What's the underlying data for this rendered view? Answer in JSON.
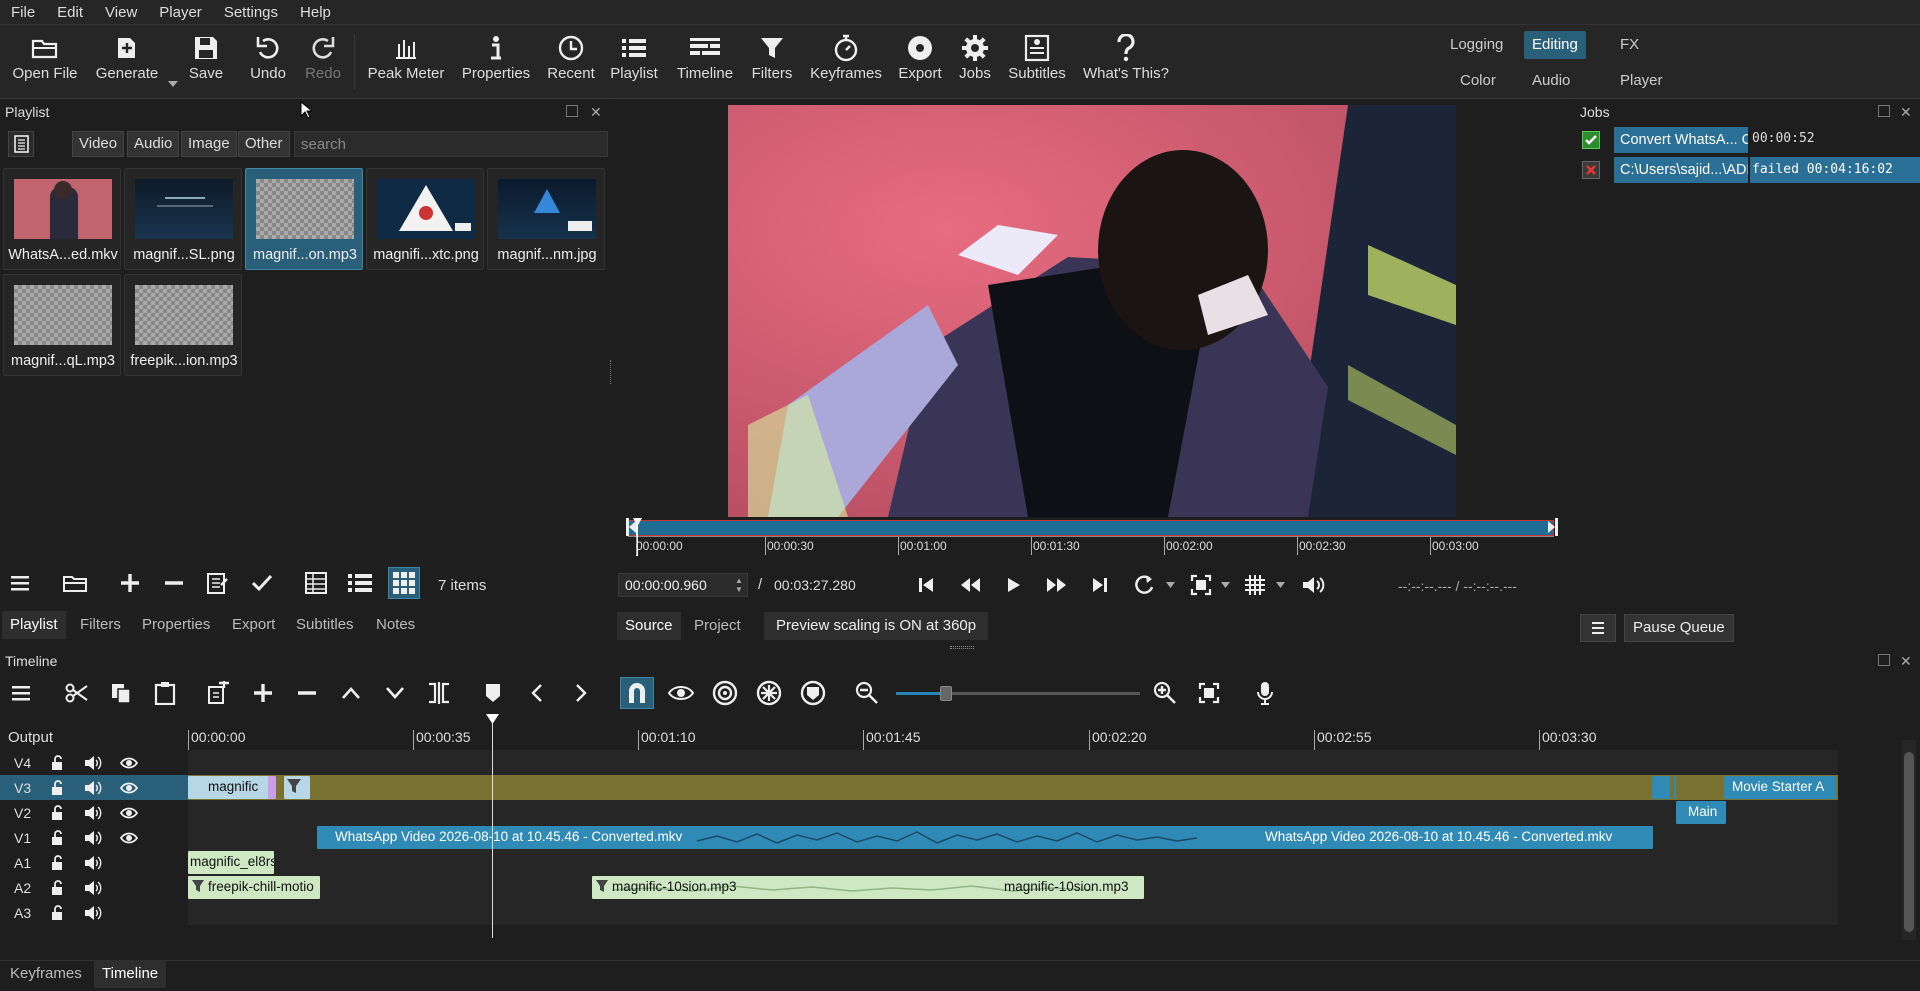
{
  "menu": [
    "File",
    "Edit",
    "View",
    "Player",
    "Settings",
    "Help"
  ],
  "toolbar": {
    "open_file": "Open File",
    "generate": "Generate",
    "save": "Save",
    "undo": "Undo",
    "redo": "Redo",
    "peak_meter": "Peak Meter",
    "properties": "Properties",
    "recent": "Recent",
    "playlist": "Playlist",
    "timeline": "Timeline",
    "filters": "Filters",
    "keyframes": "Keyframes",
    "export": "Export",
    "jobs": "Jobs",
    "subtitles": "Subtitles",
    "whats_this": "What's This?"
  },
  "layouts": {
    "logging": "Logging",
    "editing": "Editing",
    "fx": "FX",
    "color": "Color",
    "audio": "Audio",
    "player": "Player"
  },
  "playlist": {
    "title": "Playlist",
    "filters": [
      "Video",
      "Audio",
      "Image",
      "Other"
    ],
    "search_placeholder": "search",
    "items": [
      {
        "name": "WhatsA...ed.mkv"
      },
      {
        "name": "magnif...SL.png"
      },
      {
        "name": "magnif...on.mp3"
      },
      {
        "name": "magnifi...xtc.png"
      },
      {
        "name": "magnif...nm.jpg"
      },
      {
        "name": "magnif...qL.mp3"
      },
      {
        "name": "freepik...ion.mp3"
      }
    ],
    "count": "7 items"
  },
  "left_tabs": [
    "Playlist",
    "Filters",
    "Properties",
    "Export",
    "Subtitles",
    "Notes"
  ],
  "player": {
    "scrub_ticks": [
      "00:00:00",
      "00:00:30",
      "00:01:00",
      "00:01:30",
      "00:02:00",
      "00:02:30",
      "00:03:00"
    ],
    "position": "00:00:00.960",
    "separator": "/",
    "duration": "00:03:27.280",
    "in_out": "--:--:--.--- / --:--:--.---",
    "tabs": [
      "Source",
      "Project"
    ],
    "scaling_notice": "Preview scaling is ON at 360p"
  },
  "jobs": {
    "title": "Jobs",
    "rows": [
      {
        "name": "Convert WhatsA... Co",
        "status": "00:00:52",
        "ok": true
      },
      {
        "name": "C:\\Users\\sajid...\\ADM",
        "status": "failed 00:04:16:02",
        "ok": false
      }
    ],
    "pause_queue": "Pause Queue"
  },
  "timeline": {
    "title": "Timeline",
    "output_label": "Output",
    "ruler": [
      "00:00:00",
      "00:00:35",
      "00:01:10",
      "00:01:45",
      "00:02:20",
      "00:02:55",
      "00:03:30"
    ],
    "tracks": [
      "V4",
      "V3",
      "V2",
      "V1",
      "A1",
      "A2",
      "A3"
    ],
    "clips": {
      "v3_a": "magnific",
      "v3_c": "Movie Starter A",
      "v2_a": "Main",
      "v1_a": "WhatsApp Video 2026-08-10 at 10.45.46 - Converted.mkv",
      "v1_b": "WhatsApp Video 2026-08-10 at 10.45.46 - Converted.mkv",
      "a1_a": "magnific_el8rs",
      "a2_a": "freepik-chill-motio",
      "a2_b": "magnific-10sion.mp3",
      "a2_c": "magnific-10sion.mp3"
    }
  },
  "bottom_tabs": [
    "Keyframes",
    "Timeline"
  ],
  "colors": {
    "accent": "#2a5f7a",
    "v3_track": "#7a7230",
    "video_clip": "#2f8ab5",
    "audio_clip": "#cfe8c4"
  }
}
